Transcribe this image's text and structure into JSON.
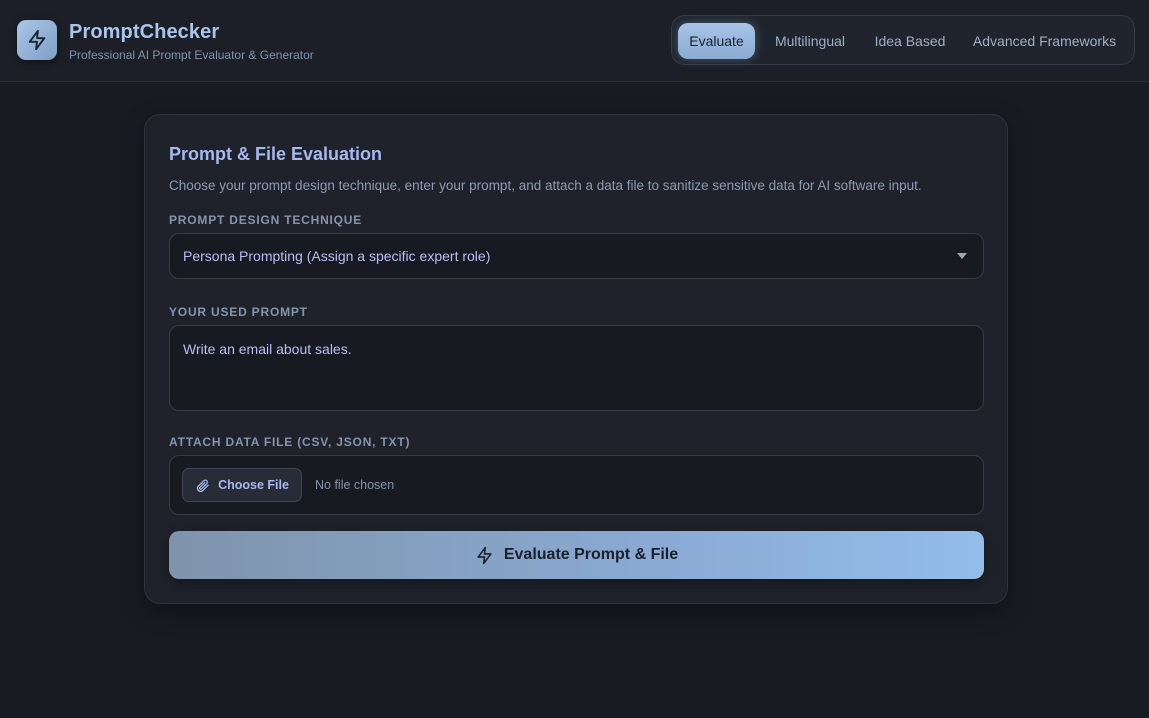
{
  "brand": {
    "title": "PromptChecker",
    "subtitle": "Professional AI Prompt Evaluator & Generator",
    "logo_icon": "lightning-bolt-icon"
  },
  "nav": {
    "tabs": [
      {
        "label": "Evaluate",
        "active": true
      },
      {
        "label": "Multilingual",
        "active": false
      },
      {
        "label": "Idea Based",
        "active": false
      },
      {
        "label": "Advanced Frameworks",
        "active": false
      }
    ]
  },
  "card": {
    "title": "Prompt & File Evaluation",
    "description": "Choose your prompt design technique, enter your prompt, and attach a data file to sanitize sensitive data for AI software input.",
    "technique": {
      "label": "PROMPT DESIGN TECHNIQUE",
      "selected": "Persona Prompting (Assign a specific expert role)"
    },
    "prompt": {
      "label": "YOUR USED PROMPT",
      "value": "Write an email about sales."
    },
    "file": {
      "label": "ATTACH DATA FILE (CSV, JSON, TXT)",
      "button_label": "Choose File",
      "button_icon": "paperclip-icon",
      "status": "No file chosen"
    },
    "submit": {
      "label": "Evaluate Prompt & File",
      "icon": "lightning-bolt-icon"
    }
  },
  "colors": {
    "background": "#181b22",
    "accent": "#a9c5ea",
    "title_accent": "#a6b8f0"
  }
}
